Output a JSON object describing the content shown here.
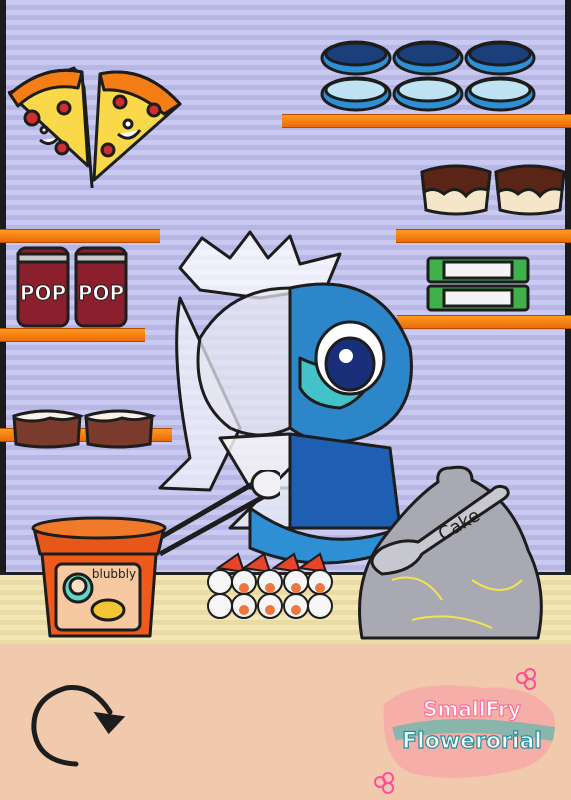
{
  "soda": {
    "label_left": "POP",
    "label_right": "POP"
  },
  "cup_noodle": {
    "brand": "blubbly"
  },
  "trash_bag": {
    "spoon_text": "Cake"
  },
  "watermark": {
    "line1": "SmallFry",
    "line2": "Flowerorial"
  },
  "colors": {
    "wall": "#c9c9f2",
    "shelf": "#f27b12",
    "counter": "#f3e7b8",
    "floor": "#f1c9ad"
  },
  "controls": {
    "replay_icon": "circular-arrow-icon"
  }
}
